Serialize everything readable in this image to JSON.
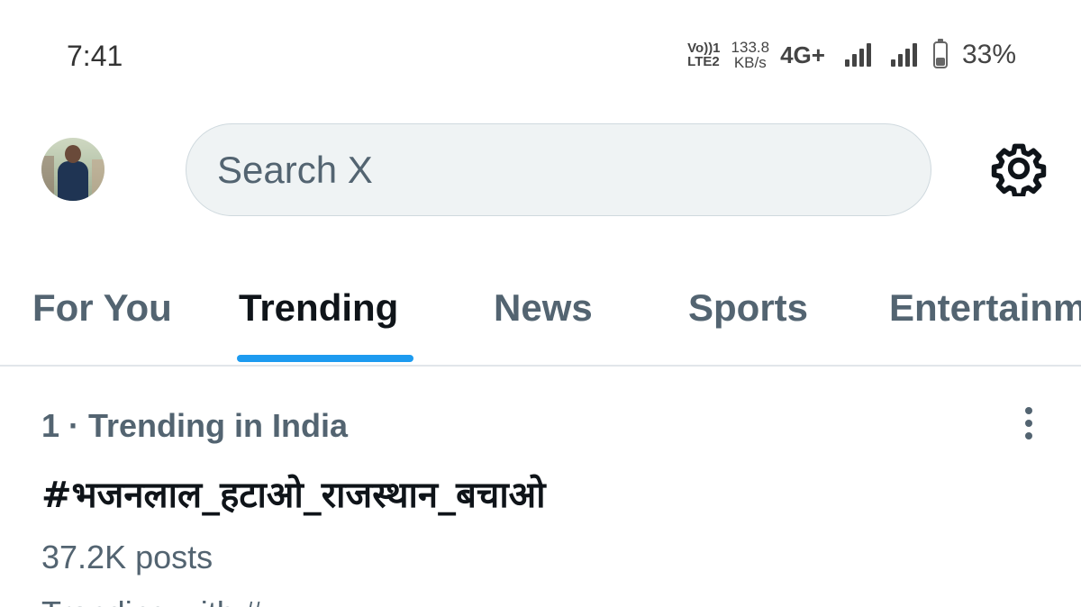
{
  "status_bar": {
    "time": "7:41",
    "volte_top": "Vo))1",
    "volte_bottom": "LTE2",
    "speed_value": "133.8",
    "speed_unit": "KB/s",
    "network": "4G+",
    "battery_level": 0.33,
    "battery_text": "33%"
  },
  "header": {
    "avatar_icon": "profile-photo",
    "search_placeholder": "Search X",
    "settings_icon": "gear-icon"
  },
  "tabs": [
    {
      "label": "For You",
      "active": false
    },
    {
      "label": "Trending",
      "active": true
    },
    {
      "label": "News",
      "active": false
    },
    {
      "label": "Sports",
      "active": false
    },
    {
      "label": "Entertainment",
      "active": false
    }
  ],
  "accent_color": "#1d9bf0",
  "trend": {
    "context": "1 · Trending in India",
    "title": "#भजनलाल_हटाओ_राजस्थान_बचाओ",
    "posts": "37.2K posts",
    "trending_with": "Trending with #..."
  }
}
